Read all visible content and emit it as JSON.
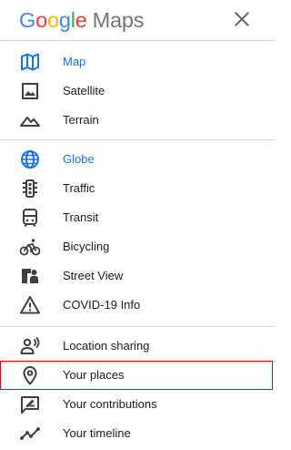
{
  "header": {
    "logo": {
      "g1": "G",
      "o1": "o",
      "o2": "o",
      "g2": "g",
      "l": "l",
      "e": "e",
      "maps": "Maps"
    },
    "close_icon": "close-icon"
  },
  "map_types": [
    {
      "label": "Map",
      "icon": "map-icon",
      "active": true
    },
    {
      "label": "Satellite",
      "icon": "satellite-icon",
      "active": false
    },
    {
      "label": "Terrain",
      "icon": "terrain-icon",
      "active": false
    }
  ],
  "layers": [
    {
      "label": "Globe",
      "icon": "globe-icon",
      "active": true
    },
    {
      "label": "Traffic",
      "icon": "traffic-icon",
      "active": false
    },
    {
      "label": "Transit",
      "icon": "transit-icon",
      "active": false
    },
    {
      "label": "Bicycling",
      "icon": "bicycle-icon",
      "active": false
    },
    {
      "label": "Street View",
      "icon": "street-view-icon",
      "active": false
    },
    {
      "label": "COVID-19 Info",
      "icon": "covid-warning-icon",
      "active": false
    }
  ],
  "personal": [
    {
      "label": "Location sharing",
      "icon": "location-sharing-icon"
    },
    {
      "label": "Your places",
      "icon": "place-pin-icon",
      "highlighted": true
    },
    {
      "label": "Your contributions",
      "icon": "contributions-icon"
    },
    {
      "label": "Your timeline",
      "icon": "timeline-icon"
    }
  ],
  "colors": {
    "active": "#1a73e8",
    "icon": "#3c4043",
    "highlight_border": "#e00000"
  }
}
